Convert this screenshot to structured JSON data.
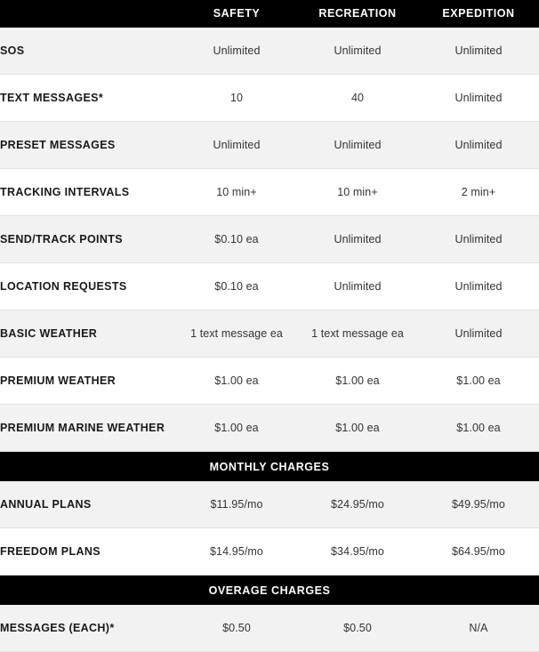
{
  "table": {
    "columns": [
      {
        "key": "label",
        "label": ""
      },
      {
        "key": "safety",
        "label": "SAFETY"
      },
      {
        "key": "recreation",
        "label": "RECREATION"
      },
      {
        "key": "expedition",
        "label": "EXPEDITION"
      }
    ],
    "colors": {
      "header_background": "#000000",
      "header_text": "#ffffff",
      "row_shaded": "#f2f2f2",
      "row_plain": "#ffffff",
      "label_text": "#18181c",
      "value_text": "#333333",
      "divider": "#e2e2e2"
    },
    "rows": [
      {
        "type": "feature",
        "shaded": true,
        "label": "SOS",
        "values": [
          "Unlimited",
          "Unlimited",
          "Unlimited"
        ]
      },
      {
        "type": "feature",
        "shaded": false,
        "label": "TEXT MESSAGES*",
        "values": [
          "10",
          "40",
          "Unlimited"
        ]
      },
      {
        "type": "feature",
        "shaded": true,
        "label": "PRESET MESSAGES",
        "values": [
          "Unlimited",
          "Unlimited",
          "Unlimited"
        ]
      },
      {
        "type": "feature",
        "shaded": false,
        "label": "TRACKING INTERVALS",
        "values": [
          "10 min+",
          "10 min+",
          "2 min+"
        ]
      },
      {
        "type": "feature",
        "shaded": true,
        "label": "SEND/TRACK POINTS",
        "values": [
          "$0.10 ea",
          "Unlimited",
          "Unlimited"
        ]
      },
      {
        "type": "feature",
        "shaded": false,
        "label": "LOCATION REQUESTS",
        "values": [
          "$0.10 ea",
          "Unlimited",
          "Unlimited"
        ]
      },
      {
        "type": "feature",
        "shaded": true,
        "label": "BASIC WEATHER",
        "values": [
          "1 text message ea",
          "1 text message ea",
          "Unlimited"
        ]
      },
      {
        "type": "feature",
        "shaded": false,
        "label": "PREMIUM WEATHER",
        "values": [
          "$1.00 ea",
          "$1.00 ea",
          "$1.00 ea"
        ]
      },
      {
        "type": "feature",
        "shaded": true,
        "label": "PREMIUM MARINE WEATHER",
        "values": [
          "$1.00 ea",
          "$1.00 ea",
          "$1.00 ea"
        ]
      },
      {
        "type": "section",
        "label": "MONTHLY CHARGES"
      },
      {
        "type": "feature",
        "shaded": true,
        "label": "ANNUAL PLANS",
        "values": [
          "$11.95/mo",
          "$24.95/mo",
          "$49.95/mo"
        ]
      },
      {
        "type": "feature",
        "shaded": false,
        "label": "FREEDOM PLANS",
        "values": [
          "$14.95/mo",
          "$34.95/mo",
          "$64.95/mo"
        ]
      },
      {
        "type": "section",
        "label": "OVERAGE CHARGES"
      },
      {
        "type": "feature",
        "shaded": true,
        "label": "MESSAGES (EACH)*",
        "values": [
          "$0.50",
          "$0.50",
          "N/A"
        ]
      }
    ]
  }
}
